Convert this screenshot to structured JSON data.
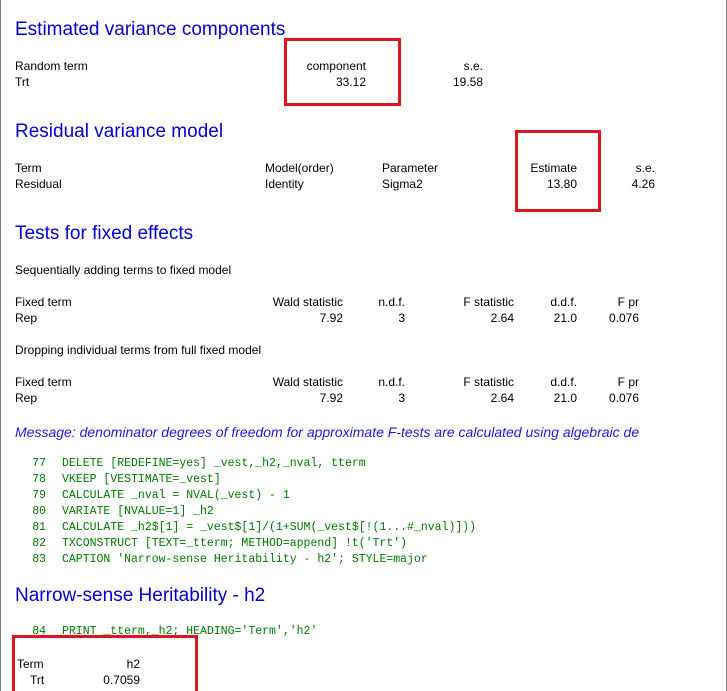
{
  "variance_components": {
    "heading": "Estimated variance components",
    "col_random_term": "Random term",
    "col_component": "component",
    "col_se": "s.e.",
    "row_term": "Trt",
    "row_component": "33.12",
    "row_se": "19.58"
  },
  "residual_model": {
    "heading": "Residual variance model",
    "col_term": "Term",
    "col_model": "Model(order)",
    "col_parameter": "Parameter",
    "col_estimate": "Estimate",
    "col_se": "s.e.",
    "row_term": "Residual",
    "row_model": "Identity",
    "row_parameter": "Sigma2",
    "row_estimate": "13.80",
    "row_se": "4.26"
  },
  "fixed_effects": {
    "heading": "Tests for fixed effects",
    "sequential_note": "Sequentially adding terms to fixed model",
    "dropping_note": "Dropping individual terms from full fixed model",
    "columns": [
      "Fixed term",
      "Wald statistic",
      "n.d.f.",
      "F statistic",
      "d.d.f.",
      "F pr"
    ],
    "sequential_row": [
      "Rep",
      "7.92",
      "3",
      "2.64",
      "21.0",
      "0.076"
    ],
    "dropping_row": [
      "Rep",
      "7.92",
      "3",
      "2.64",
      "21.0",
      "0.076"
    ]
  },
  "message": "Message: denominator degrees of freedom for approximate F-tests are calculated using algebraic de",
  "code_lines": [
    {
      "num": "77",
      "text": "DELETE [REDEFINE=yes] _vest,_h2,_nval, tterm"
    },
    {
      "num": "78",
      "text": "VKEEP [VESTIMATE=_vest]"
    },
    {
      "num": "79",
      "text": "CALCULATE _nval = NVAL(_vest) - 1"
    },
    {
      "num": "80",
      "text": "VARIATE [NVALUE=1] _h2"
    },
    {
      "num": "81",
      "text": "CALCULATE _h2$[1] = _vest$[1]/(1+SUM(_vest$[!(1...#_nval)]))"
    },
    {
      "num": "82",
      "text": "TXCONSTRUCT [TEXT=_tterm; METHOD=append] !t('Trt')"
    },
    {
      "num": "83",
      "text": "CAPTION 'Narrow-sense Heritability - h2'; STYLE=major"
    }
  ],
  "heritability": {
    "heading": "Narrow-sense Heritability - h2",
    "print_line_num": "84",
    "print_line_text": "PRINT _tterm,_h2; HEADING='Term','h2'",
    "col_term": "Term",
    "col_h2": "h2",
    "row_term": "Trt",
    "row_h2": "0.7059"
  },
  "colors": {
    "heading": "#0000d0",
    "message": "#1a1adf",
    "code": "#007a00",
    "highlight_box": "#e0141e"
  }
}
